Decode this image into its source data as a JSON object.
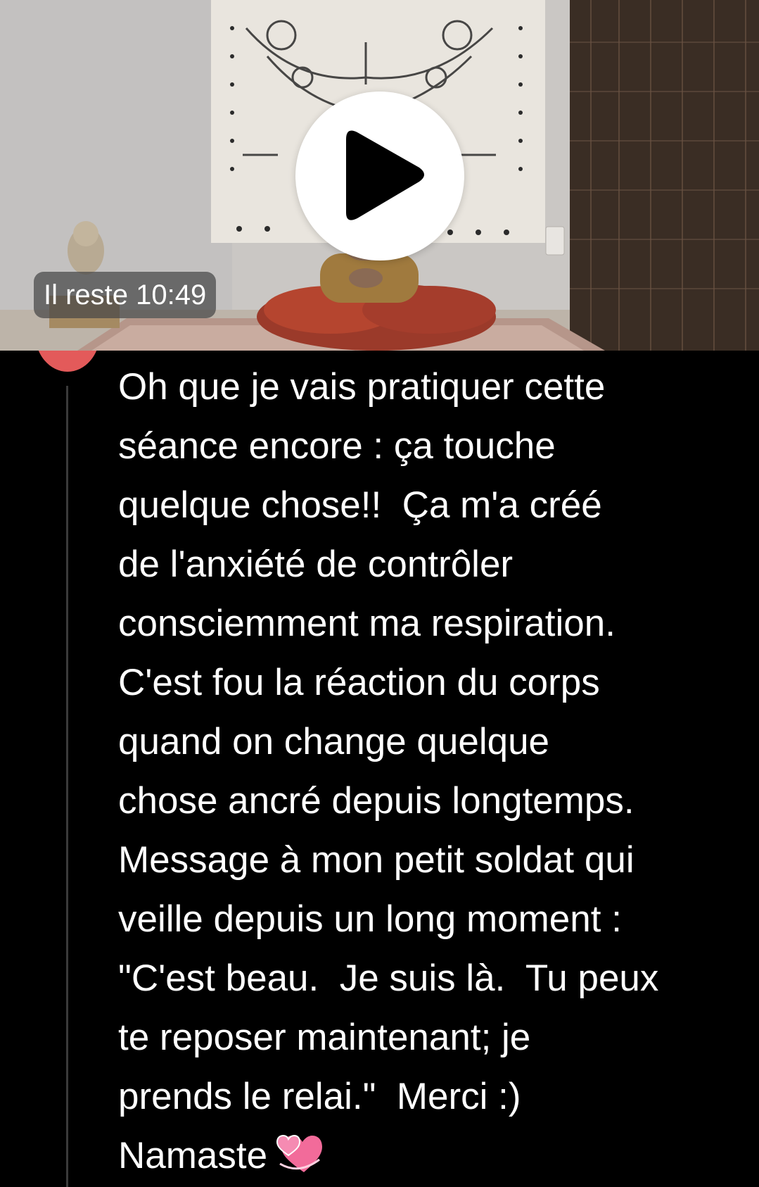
{
  "video": {
    "remaining_label": "Il reste 10:49",
    "play_icon": "play-icon"
  },
  "comment": {
    "lines": [
      "Oh que je vais pratiquer cette",
      "séance encore : ça touche",
      "quelque chose!!  Ça m'a créé",
      "de l'anxiété de contrôler",
      "consciemment ma respiration.",
      "C'est fou la réaction du corps",
      "quand on change quelque",
      "chose ancré depuis longtemps.",
      "Message à mon petit soldat qui",
      "veille depuis un long moment :",
      "\"C'est beau.  Je suis là.  Tu peux",
      "te reposer maintenant; je",
      "prends le relai.\"  Merci :)",
      "Namaste"
    ],
    "emoji": "revolving-hearts-icon"
  },
  "colors": {
    "background": "#000000",
    "text": "#ffffff",
    "avatar_accent": "#e35a5a"
  }
}
